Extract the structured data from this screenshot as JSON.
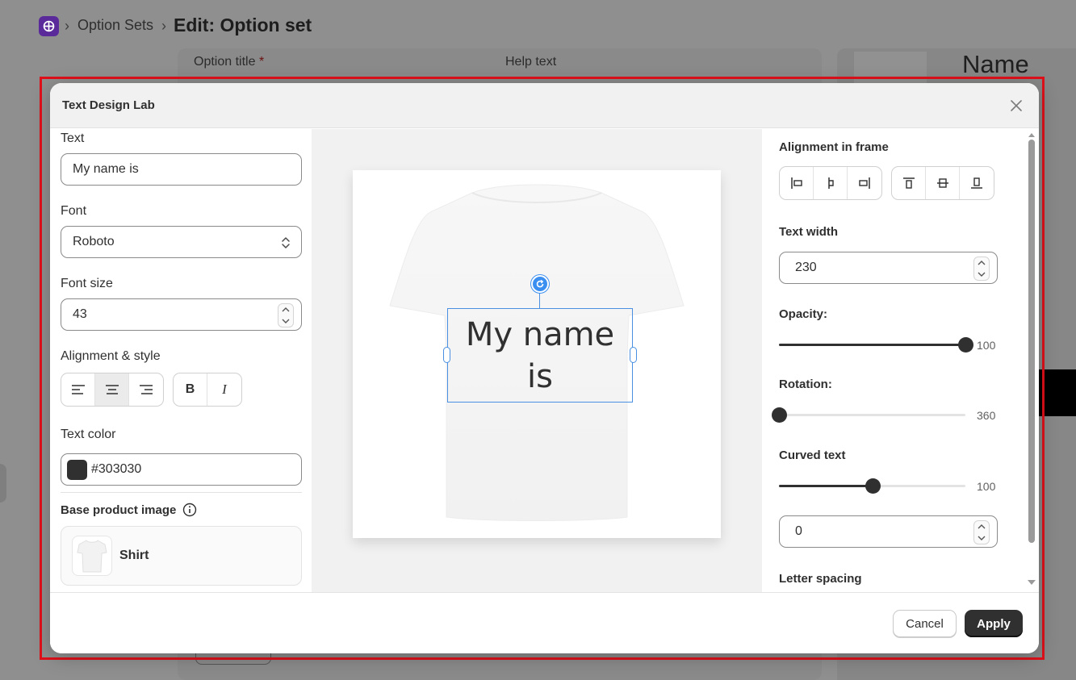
{
  "breadcrumb": {
    "parent": "Option Sets",
    "current": "Edit: Option set"
  },
  "background": {
    "option_title_label": "Option title",
    "required_mark": "*",
    "help_text_label": "Help text",
    "name_heading": "Name"
  },
  "modal": {
    "title": "Text Design Lab",
    "left": {
      "text_label": "Text",
      "text_value": "My name is",
      "font_label": "Font",
      "font_value": "Roboto",
      "font_size_label": "Font size",
      "font_size_value": "43",
      "alignment_label": "Alignment & style",
      "bold_glyph": "B",
      "italic_glyph": "I",
      "text_color_label": "Text color",
      "text_color_value": "#303030",
      "base_product_label": "Base product image",
      "product_name": "Shirt"
    },
    "canvas": {
      "preview_text": "My name is"
    },
    "right": {
      "alignment_frame_label": "Alignment in frame",
      "text_width_label": "Text width",
      "text_width_value": "230",
      "opacity_label": "Opacity:",
      "opacity_value": "100",
      "rotation_label": "Rotation:",
      "rotation_value": "360",
      "curved_label": "Curved text",
      "curved_value": "100",
      "curve_input_value": "0",
      "letter_spacing_label": "Letter spacing"
    },
    "sliders": {
      "opacity_fraction": 1.0,
      "rotation_fraction": 0.0,
      "curved_fraction": 0.5
    },
    "footer": {
      "cancel_label": "Cancel",
      "apply_label": "Apply"
    }
  },
  "colors": {
    "accent": "#303030",
    "selection": "#4a90e2",
    "highlight_frame": "#e0101a"
  }
}
